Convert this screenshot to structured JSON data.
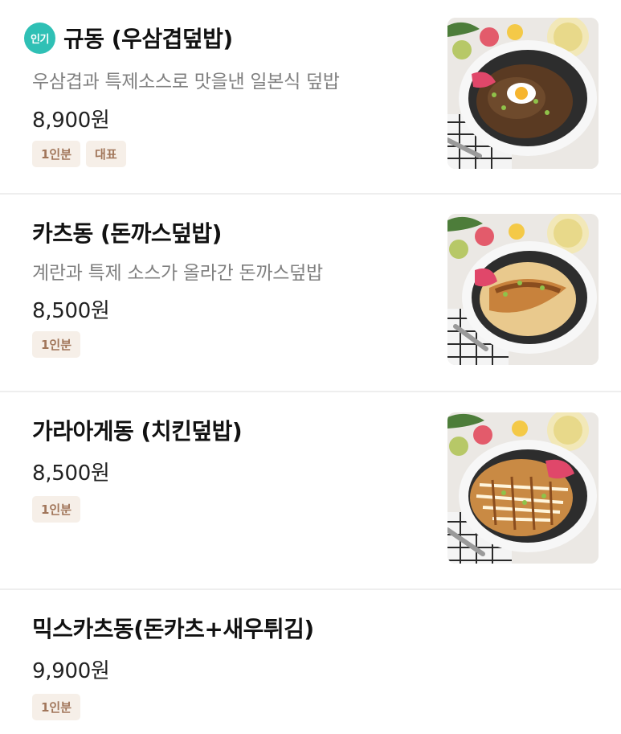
{
  "menu": {
    "popular_badge": "인기",
    "items": [
      {
        "name": "규동 (우삼겹덮밥)",
        "description": "우삼겹과 특제소스로 맛을낸 일본식 덮밥",
        "price": "8,900원",
        "tags": [
          "1인분",
          "대표"
        ],
        "image": "gyudon-photo"
      },
      {
        "name": "카츠동 (돈까스덮밥)",
        "description": "계란과 특제 소스가 올라간 돈까스덮밥",
        "price": "8,500원",
        "tags": [
          "1인분"
        ],
        "image": "katsudon-photo"
      },
      {
        "name": "가라아게동 (치킨덮밥)",
        "price": "8,500원",
        "tags": [
          "1인분"
        ],
        "image": "karaage-don-photo"
      },
      {
        "name": "믹스카츠동(돈카츠+새우튀김)",
        "price": "9,900원",
        "tags": [
          "1인분"
        ]
      }
    ]
  },
  "colors": {
    "badge_teal": "#2fc0b5",
    "tag_bg": "#f6efe8",
    "tag_text": "#a1765a",
    "divider": "#eeeeee"
  }
}
